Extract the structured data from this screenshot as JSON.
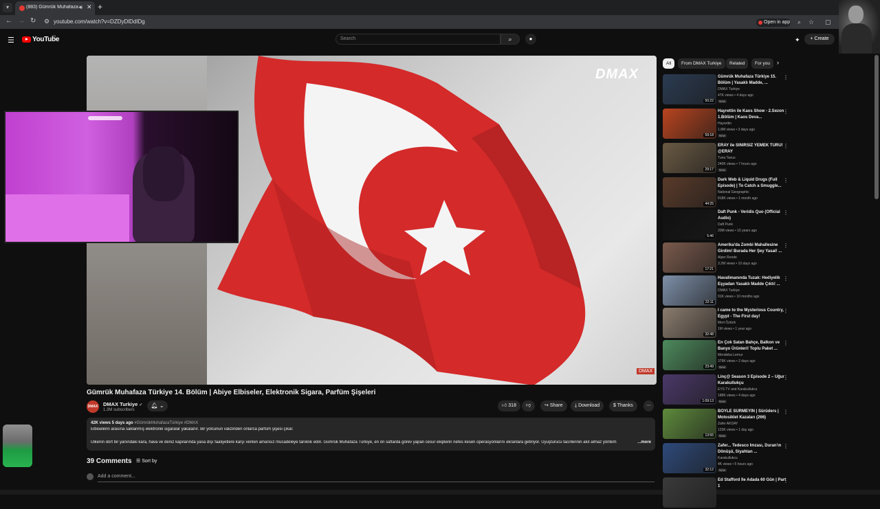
{
  "browser": {
    "tab_title": "(883) Gümrük Muhafaza Tü",
    "url": "youtube.com/watch?v=DZDyDlDdIDg",
    "open_in_app": "Open in app"
  },
  "yt": {
    "logo": "YouTube",
    "country": "TR",
    "search_placeholder": "Search",
    "create": "Create"
  },
  "video": {
    "overlay_logo": "DMAX",
    "corner_logo": "DMAX",
    "title": "Gümrük Muhafaza Türkiye 14. Bölüm | Abiye Elbiseler, Elektronik Sigara, Parfüm Şişeleri",
    "channel": "DMAX Turkiye",
    "avatar_text": "DMAX",
    "subscribers": "1.3M subscribers",
    "likes": "318",
    "share": "Share",
    "download": "Download",
    "thanks": "Thanks",
    "desc_meta": "42K views  5 days ago",
    "desc_tags": "#GümrükMuhafazaTürkiye #DMAX",
    "desc_line1": "Elbiselerin arasına saklanmış elektronik sigaralar yakalanır. Bir yolcunun valizinden onlarca parfüm şişesi çıkar.",
    "desc_line2": "Ülkenin dört bir yanındaki kara, hava ve deniz kapılarında yasa dışı faaliyetlere karşı verilen amansız mücadeleye tanıklık edin. Gümrük Muhafaza Türkiye, en ön saflarda görev yapan cesur ekiplerin nefes kesen operasyonlarını ekranlara getiriyor. Uyuşturucu tacirlerinin akıl almaz yöntem",
    "desc_more": "...more",
    "comments_count": "39 Comments",
    "sort_by": "Sort by",
    "add_comment": "Add a comment..."
  },
  "chips": [
    "All",
    "From DMAX Turkiye",
    "Related",
    "For you"
  ],
  "recommendations": [
    {
      "title": "Gümrük Muhafaza Türkiye 15. Bölüm | Yasaklı Madde, ...",
      "channel": "DMAX Turkiye",
      "views": "47K views • 4 days ago",
      "badge": "New",
      "duration": "50:22",
      "color": "#2b3b52"
    },
    {
      "title": "Hayrettin ile Kaos Show - 2.Sezon 1.Bölüm | Kaos Deva...",
      "channel": "Hayrettin",
      "views": "1.8M views • 3 days ago",
      "badge": "New",
      "duration": "59:18",
      "color": "#b8441f"
    },
    {
      "title": "ERAY ile SINIRSIZ YEMEK TURU! @ERAY",
      "channel": "Tuna Tavus",
      "views": "240K views • 7 hours ago",
      "badge": "New",
      "duration": "29:17",
      "color": "#6a5a44"
    },
    {
      "title": "Dark Web & Liquid Drugs (Full Episode) | To Catch a Smuggle...",
      "channel": "National Geographic",
      "views": "818K views • 1 month ago",
      "badge": "",
      "duration": "44:25",
      "color": "#5a3b2a"
    },
    {
      "title": "Daft Punk - Veridis Quo (Official Audio)",
      "channel": "Daft Punk",
      "views": "20M views • 10 years ago",
      "badge": "",
      "duration": "5:46",
      "color": "#111111"
    },
    {
      "title": "Amerika'da Zombi Mahallesine Girdim! Burada Her Şey Yasal! ...",
      "channel": "Alper Rende",
      "views": "3.2M views • 10 days ago",
      "badge": "",
      "duration": "17:21",
      "color": "#7a5a4c"
    },
    {
      "title": "Havalimanında Tuzak: Hediyelik Eşyadan Yasaklı Madde Çıktı! ...",
      "channel": "DMAX Turkiye",
      "views": "91K views • 10 months ago",
      "badge": "",
      "duration": "22:11",
      "color": "#7d8fa8"
    },
    {
      "title": "I came to the Mysterious Country, Egypt - The First day!",
      "channel": "Mert Öztürk",
      "views": "1M views • 1 year ago",
      "badge": "",
      "duration": "32:48",
      "color": "#8b7c6e"
    },
    {
      "title": "En Çok Satan Bahçe, Balkon ve Banyo Ürünleri! Toplu Paket ...",
      "channel": "Mendeba Lemur",
      "views": "379K views • 2 days ago",
      "badge": "New",
      "duration": "23:49",
      "color": "#4d8a5c"
    },
    {
      "title": "Linç@ Season 3 Episode 2 – Uğur Karakullukçu",
      "channel": "EYS TV and Karakullukcu",
      "views": "188K views • 4 days ago",
      "badge": "New",
      "duration": "1:09:13",
      "color": "#4a3868"
    },
    {
      "title": "BÖYLE SÜRMEYİN | Sürüders | Motosiklet Kazaları (266)",
      "channel": "Zafer AKDAY",
      "views": "133K views • 1 day ago",
      "badge": "New",
      "duration": "13:55",
      "color": "#5e8a3c"
    },
    {
      "title": "Zafer... Tedesco İmzası, Duran'ın Dönüşü, Siyahtan ...",
      "channel": "Karakullukcu",
      "views": "4K views • 5 hours ago",
      "badge": "New",
      "duration": "32:12",
      "color": "#2e4a7a"
    },
    {
      "title": "Ed Stafford İle Adada 60 Gün | Part 1",
      "channel": "",
      "views": "",
      "badge": "",
      "duration": "",
      "color": "#3a3a3a"
    }
  ]
}
